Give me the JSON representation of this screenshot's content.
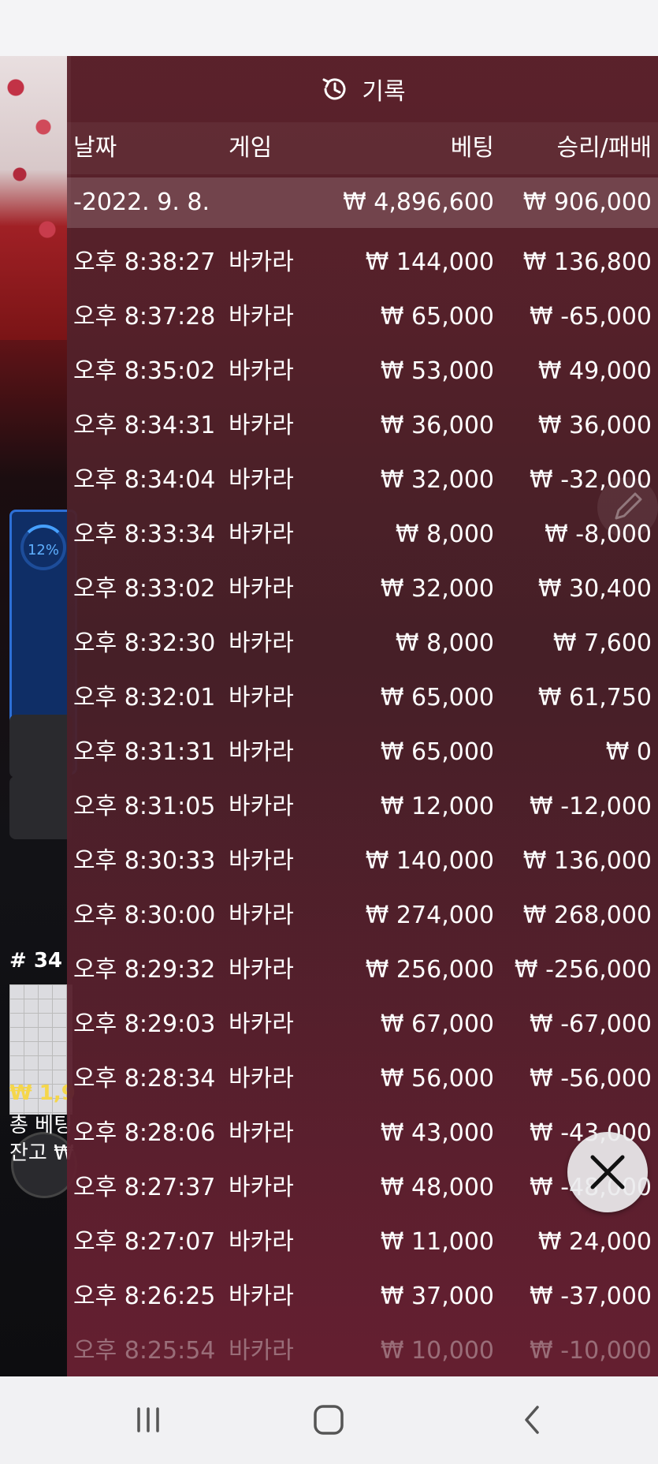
{
  "panel": {
    "title": "기록",
    "icon": "history-icon"
  },
  "columns": {
    "date": "날짜",
    "game": "게임",
    "bet": "베팅",
    "result": "승리/패배"
  },
  "summary": {
    "date": "-2022. 9. 8.",
    "bet": "₩ 4,896,600",
    "result": "₩ 906,000"
  },
  "rows": [
    {
      "time": "오후 8:38:27",
      "game": "바카라",
      "bet": "₩ 144,000",
      "result": "₩ 136,800"
    },
    {
      "time": "오후 8:37:28",
      "game": "바카라",
      "bet": "₩ 65,000",
      "result": "₩ -65,000"
    },
    {
      "time": "오후 8:35:02",
      "game": "바카라",
      "bet": "₩ 53,000",
      "result": "₩ 49,000"
    },
    {
      "time": "오후 8:34:31",
      "game": "바카라",
      "bet": "₩ 36,000",
      "result": "₩ 36,000"
    },
    {
      "time": "오후 8:34:04",
      "game": "바카라",
      "bet": "₩ 32,000",
      "result": "₩ -32,000"
    },
    {
      "time": "오후 8:33:34",
      "game": "바카라",
      "bet": "₩ 8,000",
      "result": "₩ -8,000"
    },
    {
      "time": "오후 8:33:02",
      "game": "바카라",
      "bet": "₩ 32,000",
      "result": "₩ 30,400"
    },
    {
      "time": "오후 8:32:30",
      "game": "바카라",
      "bet": "₩ 8,000",
      "result": "₩ 7,600"
    },
    {
      "time": "오후 8:32:01",
      "game": "바카라",
      "bet": "₩ 65,000",
      "result": "₩ 61,750"
    },
    {
      "time": "오후 8:31:31",
      "game": "바카라",
      "bet": "₩ 65,000",
      "result": "₩ 0"
    },
    {
      "time": "오후 8:31:05",
      "game": "바카라",
      "bet": "₩ 12,000",
      "result": "₩ -12,000"
    },
    {
      "time": "오후 8:30:33",
      "game": "바카라",
      "bet": "₩ 140,000",
      "result": "₩ 136,000"
    },
    {
      "time": "오후 8:30:00",
      "game": "바카라",
      "bet": "₩ 274,000",
      "result": "₩ 268,000"
    },
    {
      "time": "오후 8:29:32",
      "game": "바카라",
      "bet": "₩ 256,000",
      "result": "₩ -256,000"
    },
    {
      "time": "오후 8:29:03",
      "game": "바카라",
      "bet": "₩ 67,000",
      "result": "₩ -67,000"
    },
    {
      "time": "오후 8:28:34",
      "game": "바카라",
      "bet": "₩ 56,000",
      "result": "₩ -56,000"
    },
    {
      "time": "오후 8:28:06",
      "game": "바카라",
      "bet": "₩ 43,000",
      "result": "₩ -43,000"
    },
    {
      "time": "오후 8:27:37",
      "game": "바카라",
      "bet": "₩ 48,000",
      "result": "₩ -48,000"
    },
    {
      "time": "오후 8:27:07",
      "game": "바카라",
      "bet": "₩ 11,000",
      "result": "₩ 24,000"
    },
    {
      "time": "오후 8:26:25",
      "game": "바카라",
      "bet": "₩ 37,000",
      "result": "₩ -37,000"
    },
    {
      "time": "오후 8:25:54",
      "game": "바카라",
      "bet": "₩ 10,000",
      "result": "₩ -10,000"
    }
  ],
  "background": {
    "progress_label": "12%",
    "round_number": "# 34",
    "balance_partial": "₩ 1,9",
    "total_bet_partial": "총 베팅",
    "remaining_partial": "잔고 ₩"
  },
  "colors": {
    "overlay": "#5c222c",
    "background_panel_accent": "#2d6fd6",
    "balance_text": "#f5d64a"
  },
  "icons": {
    "close": "close-icon",
    "edit": "pencil-icon",
    "nav_recent": "recent-apps-icon",
    "nav_home": "home-icon",
    "nav_back": "back-icon"
  }
}
